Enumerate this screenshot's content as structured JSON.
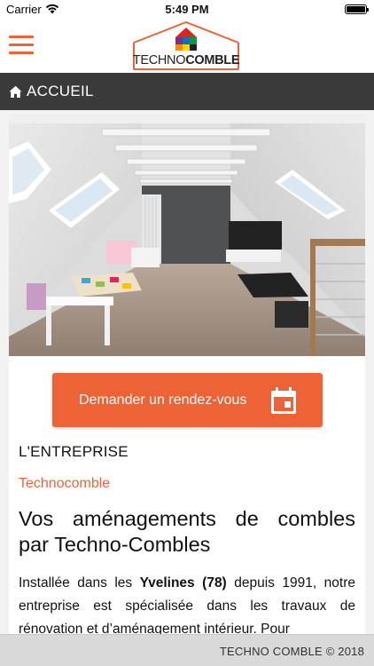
{
  "status_bar": {
    "carrier": "Carrier",
    "time": "5:49 PM"
  },
  "header": {
    "logo_text_light": "TECHNO",
    "logo_text_bold": "COMBLE",
    "menu_icon": "hamburger-icon"
  },
  "breadcrumb": {
    "icon": "home-icon",
    "label": "ACCUEIL"
  },
  "hero": {
    "icon": "attic-photo"
  },
  "cta": {
    "label": "Demander un rendez-vous",
    "icon": "calendar-icon"
  },
  "section": {
    "title": "L'ENTREPRISE",
    "subtitle": "Technocomble",
    "headline_line1": "Vos aménagements de combles",
    "headline_line2": "par Techno-Combles",
    "body_prefix": "Installée dans les ",
    "body_bold": "Yvelines (78)",
    "body_suffix": " depuis 1991, notre entreprise est spécialisée dans les travaux de rénovation et d’aménagement intérieur. Pour"
  },
  "footer": {
    "copyright": "TECHNO COMBLE © 2018"
  },
  "colors": {
    "accent": "#ee6335",
    "breadcrumb_bg": "#3a3a3a",
    "footer_bg": "#d9d9d9"
  }
}
